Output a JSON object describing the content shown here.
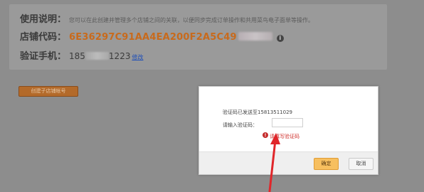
{
  "info": {
    "usage_label": "使用说明：",
    "usage_text": "您可以在此创建并管理多个店铺之间的关联，以便同步完成订单操作和共用菜鸟电子面单等操作。",
    "store_code_label": "店铺代码：",
    "store_code_value": "6E36297C91AA4EA200F2A5C49",
    "verify_phone_label": "验证手机：",
    "phone_prefix": "185",
    "phone_suffix": "1223",
    "modify_link": "修改"
  },
  "actions": {
    "create_button": "创建子店铺帐号"
  },
  "dialog": {
    "sent_message": "验证码已发送至15813511029",
    "code_label": "请输入验证码：",
    "code_value": "",
    "error_message": "请填写验证码",
    "confirm_button": "确定",
    "cancel_button": "取消"
  },
  "colors": {
    "store_code": "#c86a1c",
    "error": "#d0312d",
    "confirm_bg": "#f7bf5f",
    "arrow": "#e0262a"
  }
}
